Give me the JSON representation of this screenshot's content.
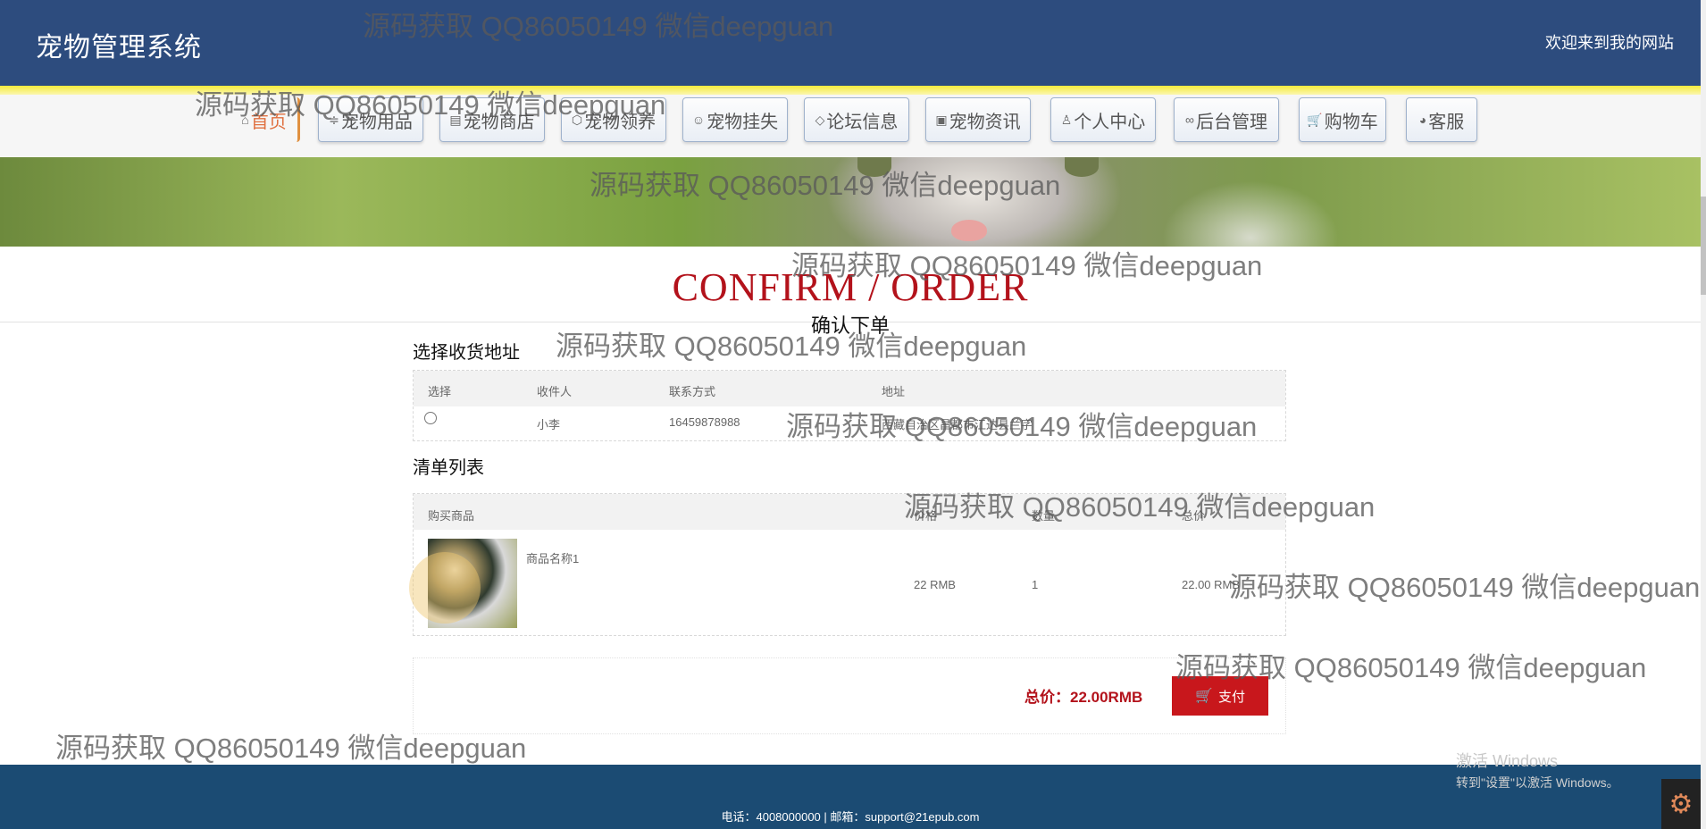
{
  "header": {
    "site_title": "宠物管理系统",
    "welcome": "欢迎来到我的网站"
  },
  "nav": {
    "items": [
      {
        "label": "首页",
        "icon": "home-icon"
      },
      {
        "label": "宠物用品",
        "icon": "sliders-icon"
      },
      {
        "label": "宠物商店",
        "icon": "store-icon"
      },
      {
        "label": "宠物领养",
        "icon": "box-icon"
      },
      {
        "label": "宠物挂失",
        "icon": "smile-icon"
      },
      {
        "label": "论坛信息",
        "icon": "tag-icon"
      },
      {
        "label": "宠物资讯",
        "icon": "news-icon"
      },
      {
        "label": "个人中心",
        "icon": "user-icon"
      },
      {
        "label": "后台管理",
        "icon": "link-icon"
      },
      {
        "label": "购物车",
        "icon": "cart-icon"
      },
      {
        "label": "客服",
        "icon": "chat-icon"
      }
    ]
  },
  "order": {
    "title": "CONFIRM / ORDER",
    "subtitle": "确认下单"
  },
  "address_section": {
    "title": "选择收货地址",
    "columns": [
      "选择",
      "收件人",
      "联系方式",
      "地址"
    ],
    "rows": [
      {
        "recipient": "小李",
        "phone": "16459878988",
        "address": "西藏自治区昌都市江达县兰字"
      }
    ]
  },
  "items_section": {
    "title": "清单列表",
    "columns": [
      "购买商品",
      "价格",
      "数量",
      "总价"
    ],
    "rows": [
      {
        "name": "商品名称1",
        "price": "22 RMB",
        "quantity": "1",
        "total": "22.00 RMB"
      }
    ]
  },
  "summary": {
    "total_label": "总价：22.00RMB",
    "pay_label": "支付"
  },
  "footer": {
    "contact": "电话：4008000000 | 邮箱：support@21epub.com"
  },
  "windows": {
    "line1": "激活 Windows",
    "line2": "转到\"设置\"以激活 Windows。"
  },
  "watermark": "源码获取 QQ86050149 微信deepguan"
}
